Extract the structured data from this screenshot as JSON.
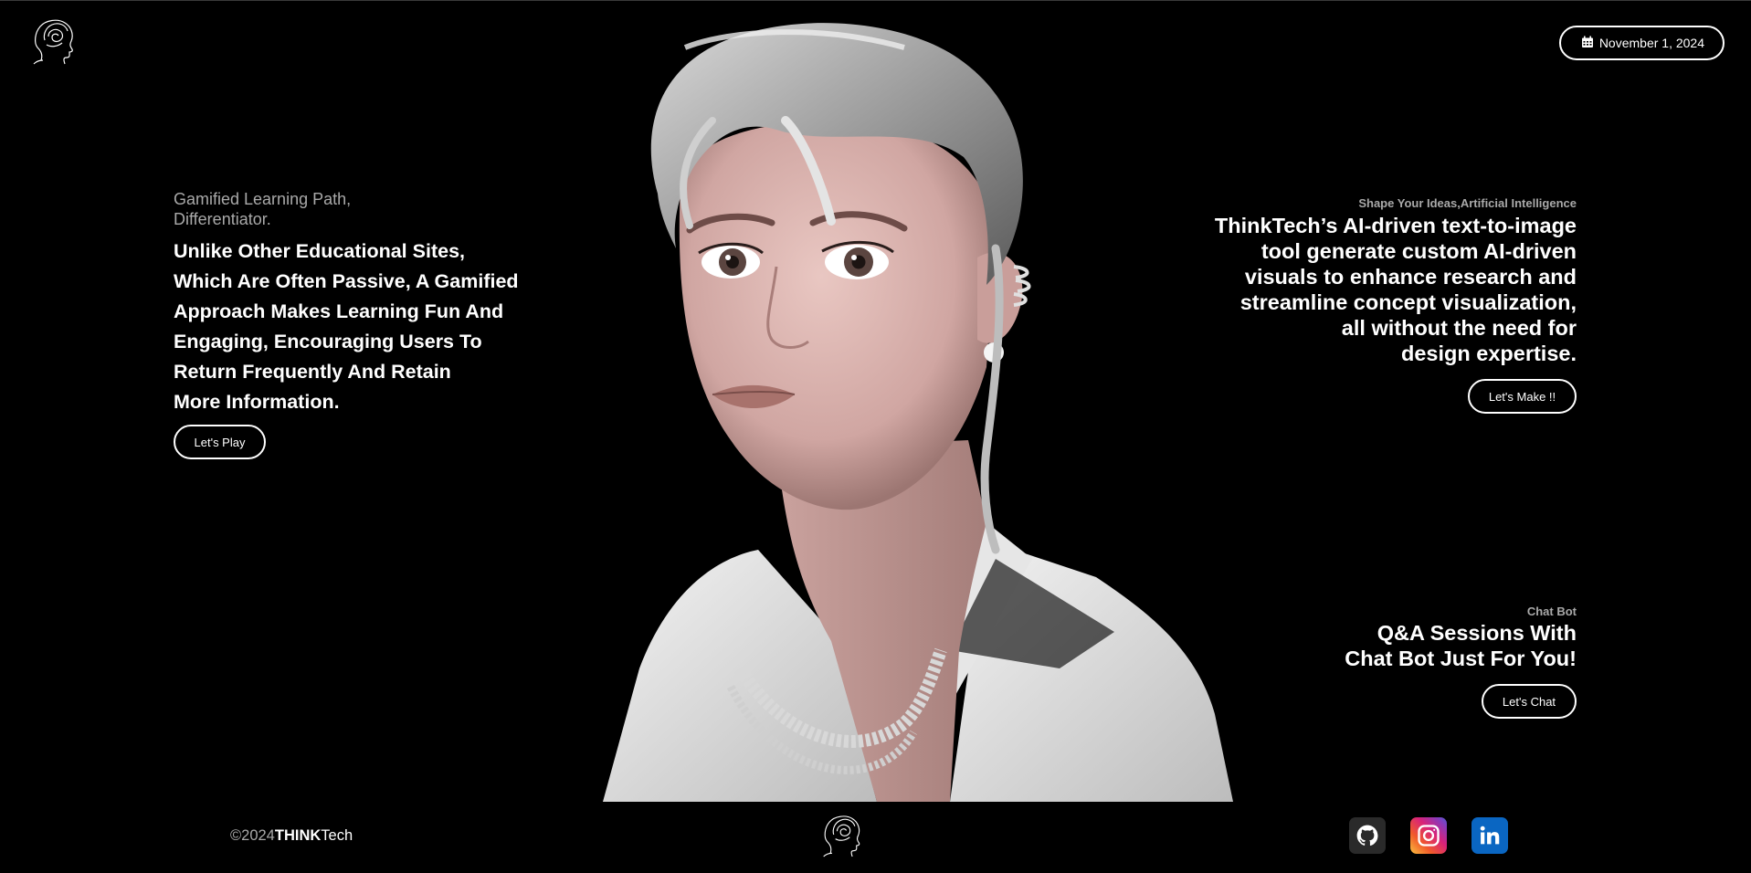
{
  "header": {
    "date": "November 1, 2024"
  },
  "left": {
    "eyebrow_line1": "Gamified Learning Path,",
    "eyebrow_line2": "Differentiator.",
    "body_lines": [
      "Unlike Other Educational Sites,",
      "Which Are Often Passive, A Gamified",
      "Approach Makes Learning Fun And",
      "Engaging, Encouraging Users To",
      "Return Frequently And Retain",
      "More Information."
    ],
    "button": "Let's Play"
  },
  "right": {
    "eyebrow": "Shape Your Ideas,Artificial Intelligence",
    "body_lines": [
      "ThinkTech’s AI-driven text-to-image",
      "tool generate custom AI-driven",
      "visuals to enhance research and",
      "streamline concept visualization,",
      "all without the need for",
      "design expertise."
    ],
    "button": "Let's Make !!"
  },
  "chat": {
    "eyebrow": "Chat Bot",
    "body_lines": [
      "Q&A Sessions With",
      "Chat Bot Just For You!"
    ],
    "button": "Let's Chat"
  },
  "footer": {
    "copy_prefix": "©2024",
    "brand_bold": "THINK",
    "brand_rest": "Tech",
    "socials": [
      "github-icon",
      "instagram-icon",
      "linkedin-icon"
    ]
  },
  "colors": {
    "background": "#000000",
    "text": "#ffffff",
    "muted": "#a9a9a9",
    "linkedin": "#0a66c2"
  }
}
